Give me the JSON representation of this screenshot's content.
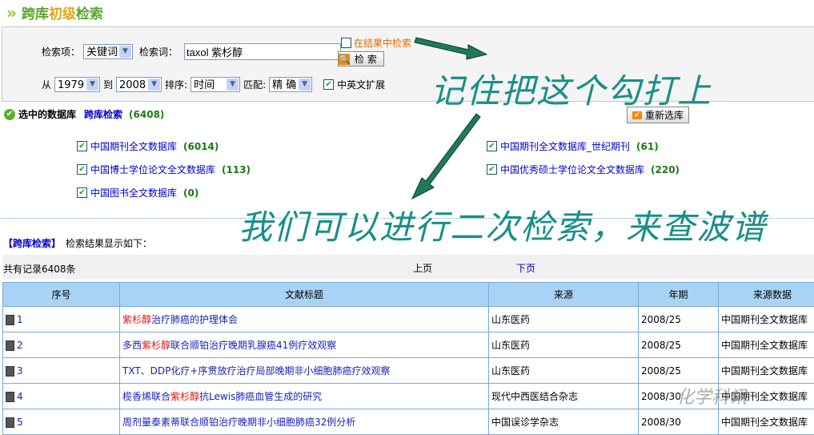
{
  "title": {
    "part1": "跨库",
    "part2": "初级",
    "part3": "检索"
  },
  "search": {
    "field_label": "检索项：",
    "field_value": "关键词",
    "term_label": "检索词：",
    "term_value": "taxol 紫杉醇",
    "in_results_label": "在结果中检索",
    "search_button": "检 索",
    "from_label": "从",
    "from_value": "1979",
    "to_label": "到",
    "to_value": "2008",
    "sort_label": "排序:",
    "sort_value": "时间",
    "match_label": "匹配:",
    "match_value": "精 确",
    "expand_label": "中英文扩展"
  },
  "selected": {
    "label": "选中的数据库",
    "link": "跨库检索",
    "count": "(6408)",
    "reselect_button": "重新选库"
  },
  "databases": [
    {
      "name": "中国期刊全文数据库",
      "count": "(6014)"
    },
    {
      "name": "中国博士学位论文全文数据库",
      "count": "(113)"
    },
    {
      "name": "中国图书全文数据库",
      "count": "(0)"
    },
    {
      "name": "中国期刊全文数据库_世纪期刊",
      "count": "(61)"
    },
    {
      "name": "中国优秀硕士学位论文全文数据库",
      "count": "(220)"
    }
  ],
  "results": {
    "tag": "【跨库检索】",
    "label": "检索结果显示如下：",
    "total": "共有记录6408条",
    "prev": "上页",
    "next": "下页"
  },
  "table": {
    "headers": [
      "序号",
      "文献标题",
      "来源",
      "年期",
      "来源数据"
    ],
    "rows": [
      {
        "no": "1",
        "pre": "",
        "hl": "紫杉醇",
        "post": "治疗肺癌的护理体会",
        "source": "山东医药",
        "issue": "2008/25",
        "db": "中国期刊全文数据库"
      },
      {
        "no": "2",
        "pre": "多西",
        "hl": "紫杉醇",
        "post": "联合顺铂治疗晚期乳腺癌41例疗效观察",
        "source": "山东医药",
        "issue": "2008/25",
        "db": "中国期刊全文数据库"
      },
      {
        "no": "3",
        "pre": "TXT、DDP化疗+序贯放疗治疗局部晚期非小细胞肺癌疗效观察",
        "hl": "",
        "post": "",
        "source": "山东医药",
        "issue": "2008/25",
        "db": "中国期刊全文数据库"
      },
      {
        "no": "4",
        "pre": "榄香烯联合",
        "hl": "紫杉醇",
        "post": "抗Lewis肺癌血管生成的研究",
        "source": "现代中西医结合杂志",
        "issue": "2008/30",
        "db": "中国期刊全文数据库"
      },
      {
        "no": "5",
        "pre": "周剂量泰素蒂联合顺铂治疗晚期非小细胞肺癌32例分析",
        "hl": "",
        "post": "",
        "source": "中国误诊学杂志",
        "issue": "2008/30",
        "db": "中国期刊全文数据库"
      }
    ]
  },
  "annotations": {
    "note1": "记住把这个勾打上",
    "note2": "我们可以进行二次检索，来查波谱"
  },
  "watermark": "化学科讯"
}
